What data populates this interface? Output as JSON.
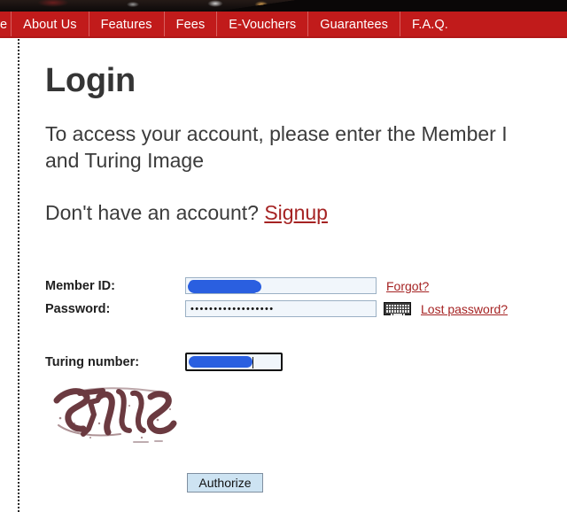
{
  "banner": {
    "alt": "site header photo strip"
  },
  "nav": {
    "items": [
      {
        "label": "e",
        "clipped": true
      },
      {
        "label": "About Us",
        "clipped": false
      },
      {
        "label": "Features",
        "clipped": false
      },
      {
        "label": "Fees",
        "clipped": false
      },
      {
        "label": "E-Vouchers",
        "clipped": false
      },
      {
        "label": "Guarantees",
        "clipped": false
      },
      {
        "label": "F.A.Q.",
        "clipped": false
      }
    ],
    "background_color": "#c11b1b",
    "divider_color": "#d8605f",
    "text_color": "#ffffff"
  },
  "page": {
    "title": "Login",
    "intro": "To access your account, please enter the Member I\nand Turing Image",
    "signup_prompt": "Don't have an account? ",
    "signup_link": "Signup",
    "link_color": "#a52323"
  },
  "form": {
    "member_id": {
      "label": "Member ID:",
      "value": "",
      "redacted": true,
      "forgot_link": "Forgot?"
    },
    "password": {
      "label": "Password:",
      "value": "••••••••••••••••••",
      "lost_link": "Lost password?",
      "keyboard_icon": "virtual-keyboard-icon"
    },
    "turing": {
      "label": "Turing number:",
      "value": "",
      "redacted": true,
      "focused": true,
      "captcha_alt": "distorted turing captcha image"
    },
    "submit_label": "Authorize"
  }
}
